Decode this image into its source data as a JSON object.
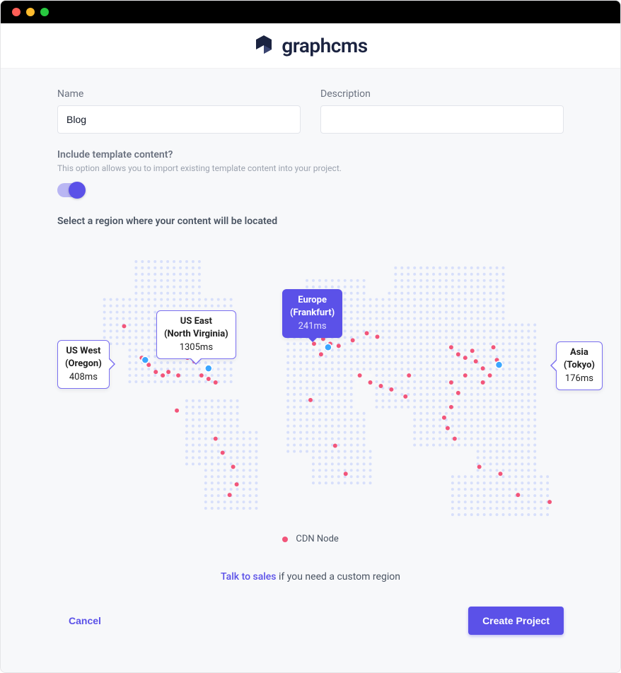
{
  "brand": {
    "name": "graphcms"
  },
  "form": {
    "name_label": "Name",
    "name_value": "Blog",
    "description_label": "Description",
    "description_value": "",
    "include_question": "Include template content?",
    "include_help": "This option allows you to import existing template content into your project.",
    "include_on": true
  },
  "region": {
    "heading": "Select a region where your content will be located",
    "legend_label": "CDN Node",
    "options": [
      {
        "id": "us-west",
        "title": "US West",
        "subtitle": "(Oregon)",
        "latency": "408ms",
        "selected": false
      },
      {
        "id": "us-east",
        "title": "US East",
        "subtitle": "(North Virginia)",
        "latency": "1305ms",
        "selected": false
      },
      {
        "id": "eu",
        "title": "Europe",
        "subtitle": "(Frankfurt)",
        "latency": "241ms",
        "selected": true
      },
      {
        "id": "asia",
        "title": "Asia",
        "subtitle": "(Tokyo)",
        "latency": "176ms",
        "selected": false
      }
    ]
  },
  "help": {
    "link_text": "Talk to sales",
    "suffix_text": " if you need a custom region"
  },
  "actions": {
    "cancel": "Cancel",
    "create": "Create Project"
  }
}
